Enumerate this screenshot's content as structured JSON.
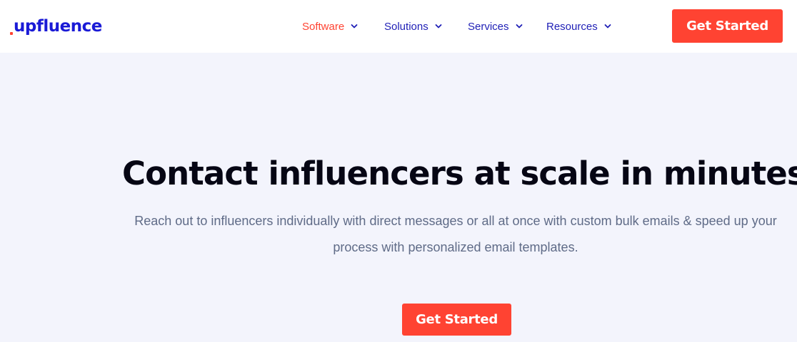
{
  "header": {
    "logo_text": "upfluence",
    "nav": [
      {
        "label": "Software",
        "active": true
      },
      {
        "label": "Solutions",
        "active": false
      },
      {
        "label": "Services",
        "active": false
      },
      {
        "label": "Resources",
        "active": false
      }
    ],
    "cta_label": "Get Started"
  },
  "hero": {
    "title": "Contact influencers at scale in minutes",
    "subtitle": "Reach out to influencers individually with direct messages or all at once with custom bulk emails & speed up your process with personalized email templates.",
    "cta_label": "Get Started"
  },
  "colors": {
    "brand_blue": "#1a1ad6",
    "accent_red": "#ff4332",
    "hero_background": "#f3f4fc"
  },
  "icons": {
    "dropdown": "chevron-down-icon"
  }
}
